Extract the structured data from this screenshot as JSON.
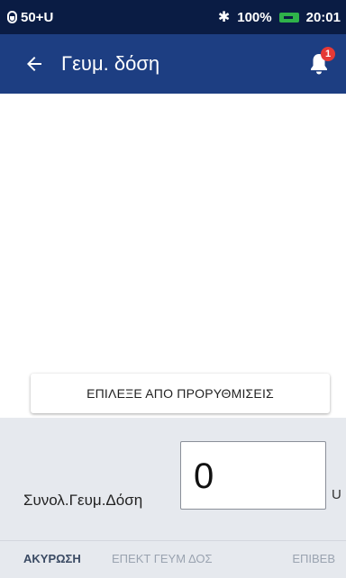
{
  "status": {
    "pod_text": "50+U",
    "battery_percent": "100%",
    "time": "20:01"
  },
  "appbar": {
    "title": "Γευμ. δόση",
    "notification_count": "1"
  },
  "preset_button": "ΕΠΙΛΕΞΕ ΑΠΟ ΠΡΟΡΥΘΜΙΣΕΙΣ",
  "dose": {
    "label": "Συνολ.Γευμ.Δόση",
    "value": "0",
    "unit": "U"
  },
  "actions": {
    "cancel": "ΑΚΥΡΩΣΗ",
    "extended": "ΕΠΕΚΤ ΓΕΥΜ ΔΟΣ",
    "confirm": "ΕΠΙΒΕΒ"
  },
  "colors": {
    "statusbar": "#0a1c44",
    "appbar": "#1d3e82",
    "panel": "#e6e9ee",
    "badge": "#e53935",
    "battery": "#2fb24a"
  }
}
